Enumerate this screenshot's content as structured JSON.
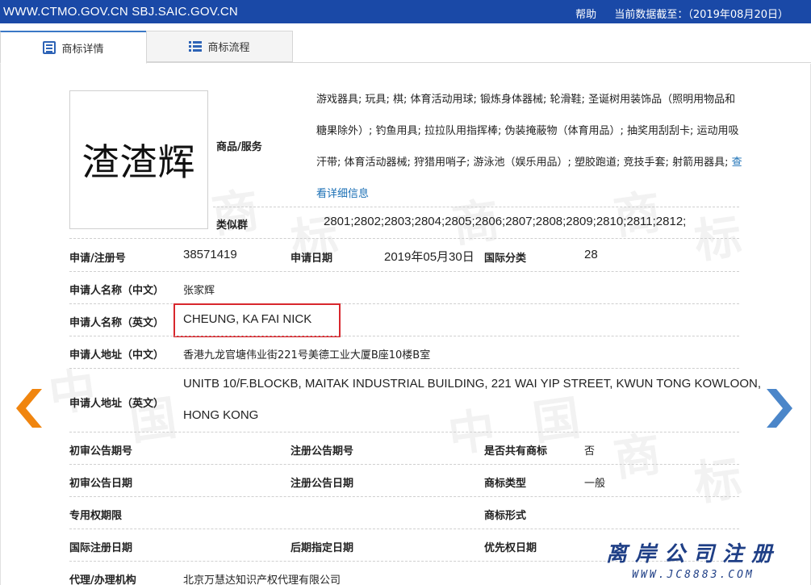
{
  "topbar": {
    "site": "WWW.CTMO.GOV.CN SBJ.SAIC.GOV.CN",
    "help": "帮助",
    "data_date": "当前数据截至：（2019年08月20日）",
    "bg_color": "#1a49a7"
  },
  "tabs": [
    {
      "label": "商标详情",
      "icon": "document-icon",
      "active": true
    },
    {
      "label": "商标流程",
      "icon": "list-icon",
      "active": false
    }
  ],
  "trademark": {
    "image_text": "渣渣辉",
    "goods_label": "商品/服务",
    "goods_text": "游戏器具; 玩具; 棋; 体育活动用球; 锻炼身体器械; 轮滑鞋; 圣诞树用装饰品（照明用物品和糖果除外）; 钓鱼用具; 拉拉队用指挥棒; 伪装掩蔽物（体育用品）; 抽奖用刮刮卡; 运动用吸汗带; 体育活动器械; 狩猎用哨子; 游泳池（娱乐用品）; 塑胶跑道; 竞技手套; 射箭用器具;",
    "goods_more_link": "查看详细信息",
    "similar_label": "类似群",
    "similar_value": "2801;2802;2803;2804;2805;2806;2807;2808;2809;2810;2811;2812;"
  },
  "fields": {
    "reg_no_label": "申请/注册号",
    "reg_no": "38571419",
    "apply_date_label": "申请日期",
    "apply_date": "2019年05月30日",
    "intl_class_label": "国际分类",
    "intl_class": "28",
    "applicant_cn_label": "申请人名称（中文）",
    "applicant_cn": "张家辉",
    "applicant_en_label": "申请人名称（英文）",
    "applicant_en": "CHEUNG, KA FAI NICK",
    "address_cn_label": "申请人地址（中文）",
    "address_cn": "香港九龙官塘伟业街221号美德工业大厦B座10楼B室",
    "address_en_label": "申请人地址（英文）",
    "address_en_line1": "UNITB 10/F.BLOCKB, MAITAK INDUSTRIAL BUILDING, 221 WAI YIP STREET, KWUN TONG KOWLOON,",
    "address_en_line2": "HONG KONG",
    "prelim_no_label": "初审公告期号",
    "reg_pub_no_label": "注册公告期号",
    "shared_label": "是否共有商标",
    "shared_value": "否",
    "prelim_date_label": "初审公告日期",
    "reg_pub_date_label": "注册公告日期",
    "tm_type_label": "商标类型",
    "tm_type_value": "一般",
    "exclusive_label": "专用权期限",
    "tm_form_label": "商标形式",
    "intl_reg_date_label": "国际注册日期",
    "later_date_label": "后期指定日期",
    "priority_date_label": "优先权日期",
    "agent_label": "代理/办理机构",
    "agent_value": "北京万慧达知识产权代理有限公司"
  },
  "nav": {
    "prev_icon": "chevron-left-icon",
    "next_icon": "chevron-right-icon",
    "prev_color": "#f0850f",
    "next_color": "#4b86c9"
  },
  "logo": {
    "cn": "离岸公司注册",
    "url": "WWW.JC8883.COM"
  },
  "watermark": {
    "chars": [
      "中",
      "国",
      "商",
      "标"
    ]
  }
}
